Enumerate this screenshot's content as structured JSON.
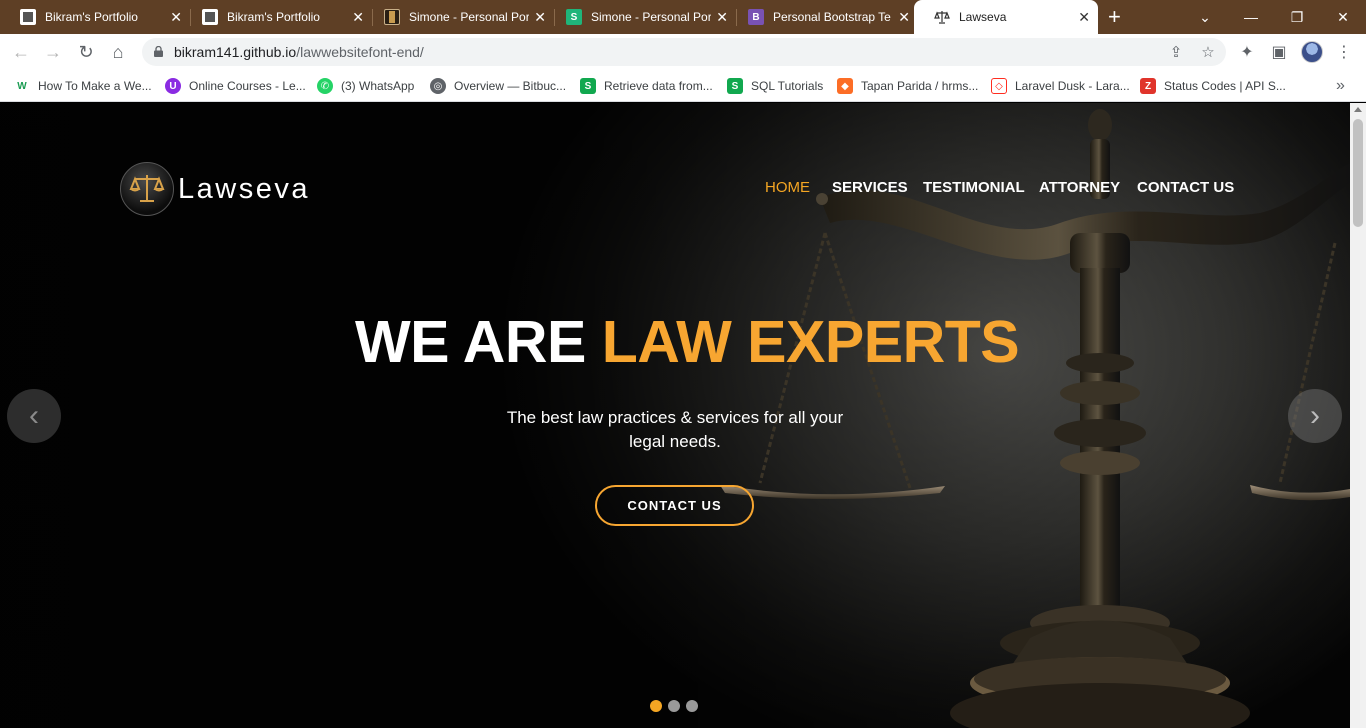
{
  "browser": {
    "tabs": [
      {
        "title": "Bikram's Portfolio",
        "icon": "portfolio-favicon"
      },
      {
        "title": "Bikram's Portfolio",
        "icon": "portfolio-favicon"
      },
      {
        "title": "Simone - Personal Por",
        "icon": "simone-favicon"
      },
      {
        "title": "Simone - Personal Por",
        "icon": "simone-s-favicon"
      },
      {
        "title": "Personal Bootstrap Te",
        "icon": "bootstrap-favicon"
      },
      {
        "title": "Lawseva",
        "icon": "scales-favicon",
        "active": true
      }
    ],
    "url_host": "bikram141.github.io",
    "url_path": "/lawwebsitefont-end/",
    "bookmarks": [
      {
        "label": "How To Make a We...",
        "badge": "W"
      },
      {
        "label": "Online Courses - Le...",
        "badge": "U"
      },
      {
        "label": "(3) WhatsApp",
        "badge": "✆"
      },
      {
        "label": "Overview — Bitbuc...",
        "badge": "◎"
      },
      {
        "label": "Retrieve data from...",
        "badge": "S"
      },
      {
        "label": "SQL Tutorials",
        "badge": "S"
      },
      {
        "label": "Tapan Parida / hrms...",
        "badge": "◆"
      },
      {
        "label": "Laravel Dusk - Lara...",
        "badge": "◇"
      },
      {
        "label": "Status Codes | API S...",
        "badge": "Z"
      }
    ]
  },
  "site": {
    "logo_text": "Lawseva",
    "nav": [
      "HOME",
      "SERVICES",
      "TESTIMONIAL",
      "ATTORNEY",
      "CONTACT US"
    ],
    "headline_white": "WE ARE ",
    "headline_accent": "LAW EXPERTS",
    "subline": "The best law practices & services for all your legal needs.",
    "cta": "CONTACT US",
    "carousel": {
      "slides": 3,
      "active": 0
    }
  },
  "colors": {
    "accent": "#f7a631",
    "tabbar": "#5e3f25"
  }
}
